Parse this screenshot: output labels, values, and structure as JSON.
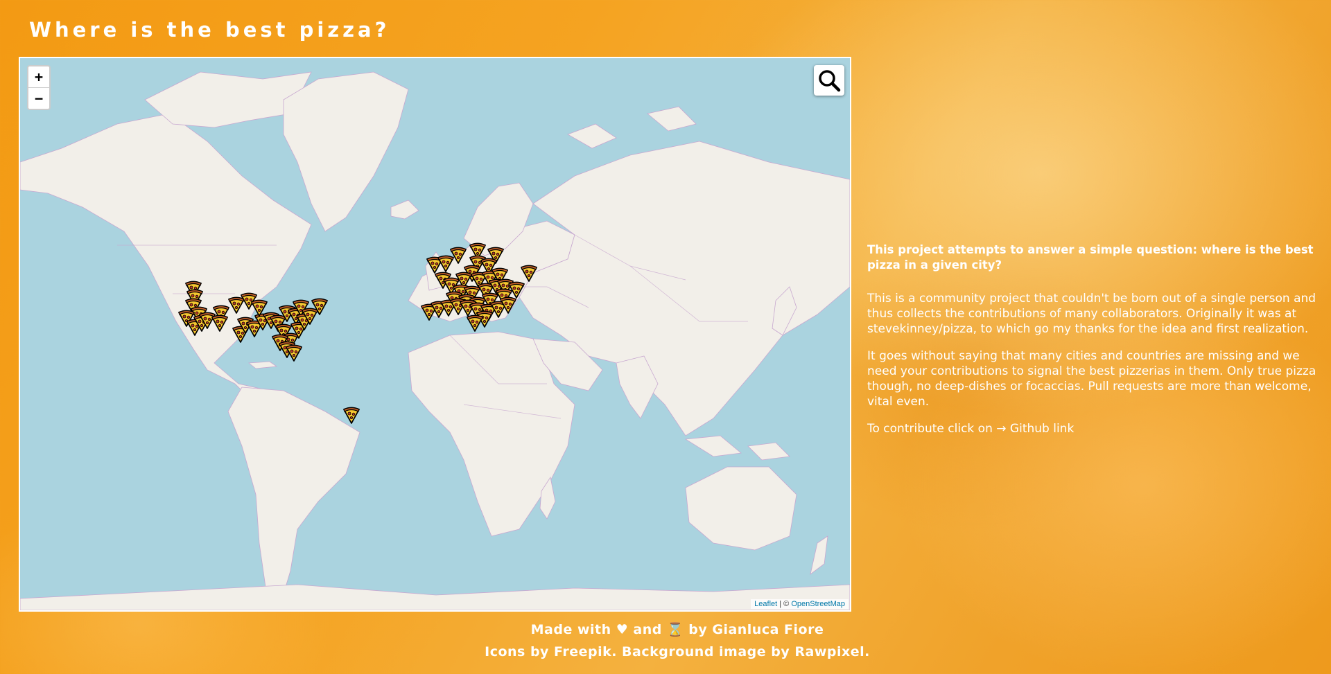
{
  "page": {
    "title": "Where is the best pizza?"
  },
  "map": {
    "zoom_in_label": "+",
    "zoom_out_label": "−",
    "search_icon": "magnifier-icon",
    "marker_icon": "pizza-slice-icon",
    "attribution": {
      "leaflet": "Leaflet",
      "separator": " | © ",
      "osm": "OpenStreetMap"
    },
    "colors": {
      "water": "#aad3df",
      "land": "#f2efe9",
      "borders": "#c8a8d0"
    }
  },
  "info": {
    "lead": "This project attempts to answer a simple question: where is the best pizza in a given city?",
    "paragraph1": "This is a community project that couldn't be born out of a single person and thus collects the contributions of many collaborators. Originally it was at stevekinney/pizza, to which go my thanks for the idea and first realization.",
    "paragraph2": "It goes without saying that many cities and countries are missing and we need your contributions to signal the best pizzerias in them. Only true pizza though, no deep-dishes or focaccias. Pull requests are more than welcome, vital even.",
    "contribute_prefix": "To contribute click on → ",
    "contribute_link": "Github link"
  },
  "footer": {
    "line1": "Made with ♥ and ⌛ by Gianluca Fiore",
    "line2": "Icons by Freepik. Background image by Rawpixel."
  },
  "colors": {
    "background": "#f39a13",
    "text": "#ffffff"
  }
}
